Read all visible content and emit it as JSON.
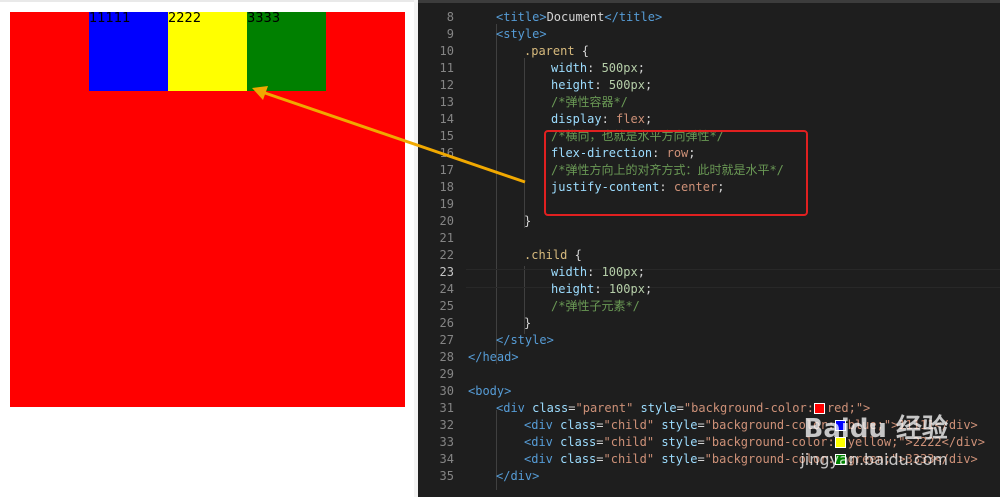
{
  "preview": {
    "children": [
      {
        "label": "11111",
        "color": "#0000ff"
      },
      {
        "label": "2222",
        "color": "#ffff00"
      },
      {
        "label": "3333",
        "color": "#008000"
      }
    ],
    "parent_color": "#ff0000"
  },
  "editor": {
    "line_numbers": [
      "8",
      "9",
      "10",
      "11",
      "12",
      "13",
      "14",
      "15",
      "16",
      "17",
      "18",
      "19",
      "20",
      "21",
      "22",
      "23",
      "24",
      "25",
      "26",
      "27",
      "28",
      "29",
      "30",
      "31",
      "32",
      "33",
      "34",
      "35"
    ],
    "active_line": "23",
    "lines": {
      "l8": {
        "open": "<title>",
        "text": "Document",
        "close": "</title>"
      },
      "l9": {
        "open": "<style>"
      },
      "l10": {
        "sel": ".parent",
        "brace": " {"
      },
      "l11": {
        "prop": "width",
        "num": "500px"
      },
      "l12": {
        "prop": "height",
        "num": "500px"
      },
      "l13": {
        "cmt": "/*弹性容器*/"
      },
      "l14": {
        "prop": "display",
        "val": "flex"
      },
      "l15": {
        "cmt": "/*横向，也就是水平方向弹性*/"
      },
      "l16": {
        "prop": "flex-direction",
        "val": "row"
      },
      "l17": {
        "cmt": "/*弹性方向上的对齐方式：此时就是水平*/"
      },
      "l18": {
        "prop": "justify-content",
        "val": "center"
      },
      "l20": {
        "brace": "}"
      },
      "l22": {
        "sel": ".child",
        "brace": " {"
      },
      "l23": {
        "prop": "width",
        "num": "100px"
      },
      "l24": {
        "prop": "height",
        "num": "100px"
      },
      "l25": {
        "cmt": "/*弹性子元素*/"
      },
      "l26": {
        "brace": "}"
      },
      "l27": {
        "close": "</style>"
      },
      "l28": {
        "close": "</head>"
      },
      "l30": {
        "open": "<body>"
      },
      "l31": {
        "tag": "<div",
        "attr": "class",
        "s1": "\"parent\"",
        "attr2": "style",
        "s2": "\"background-color:",
        "tail": "red;\">"
      },
      "l32": {
        "tag": "<div",
        "attr": "class",
        "s1": "\"child\"",
        "attr2": "style",
        "s2": "\"background-color:",
        "tail": "blue;\">11111</div>"
      },
      "l33": {
        "tag": "<div",
        "attr": "class",
        "s1": "\"child\"",
        "attr2": "style",
        "s2": "\"background-color:",
        "tail": "yellow;\">2222</div>"
      },
      "l34": {
        "tag": "<div",
        "attr": "class",
        "s1": "\"child\"",
        "attr2": "style",
        "s2": "\"background-color:",
        "tail": "green;\">3333</div>"
      },
      "l35": {
        "close": "</div>"
      }
    }
  },
  "watermark": {
    "title": "Baidu 经验",
    "sub": "jingyan.baidu.com"
  },
  "colors": {
    "accent_box": "#e02020",
    "arrow": "#f0a800"
  }
}
